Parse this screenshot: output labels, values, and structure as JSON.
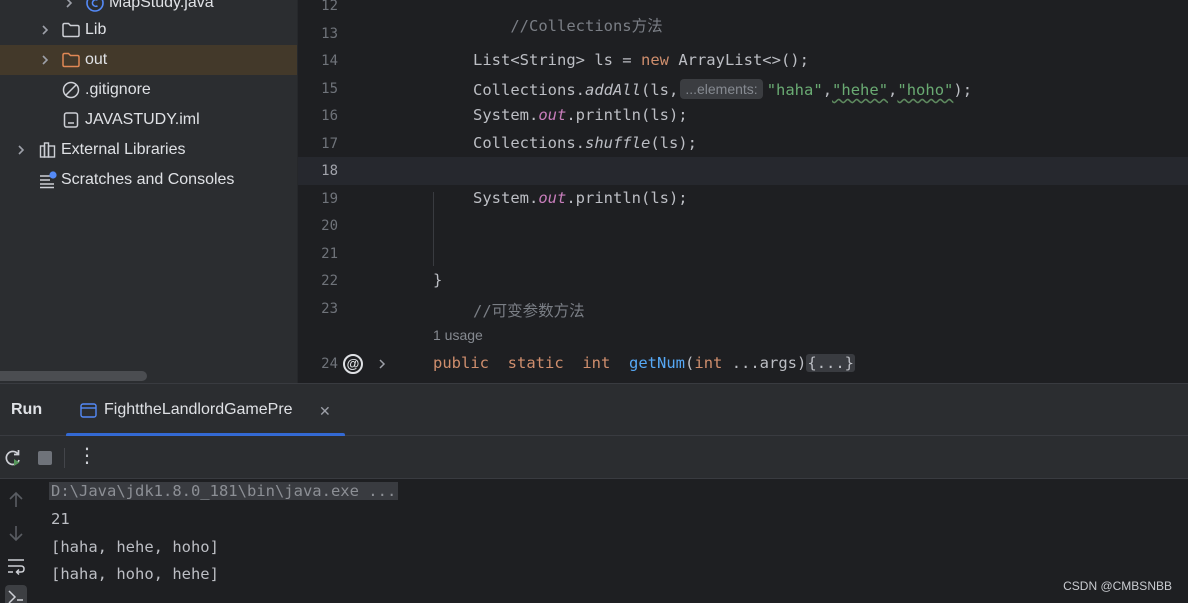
{
  "project_tree": {
    "items": [
      {
        "label": "MapStudy.java",
        "kind": "java-class",
        "expanded": false
      },
      {
        "label": "Lib",
        "kind": "folder",
        "expanded": false
      },
      {
        "label": "out",
        "kind": "excluded-folder",
        "expanded": false,
        "selected": true
      },
      {
        "label": ".gitignore",
        "kind": "ignored-file"
      },
      {
        "label": "JAVASTUDY.iml",
        "kind": "module-file"
      },
      {
        "label": "External Libraries",
        "kind": "libraries",
        "expanded": false
      },
      {
        "label": "Scratches and Consoles",
        "kind": "scratches"
      }
    ]
  },
  "editor": {
    "line_numbers": [
      "12",
      "13",
      "14",
      "15",
      "16",
      "17",
      "18",
      "19",
      "20",
      "21",
      "22",
      "23",
      "24"
    ],
    "current_line": "18",
    "code": {
      "l12_comment": "//Collections方法",
      "l14_type": "List<String> ls = ",
      "l14_new": "new",
      "l14_rest": " ArrayList<>();",
      "l15_a": "Collections.",
      "l15_method": "addAll",
      "l15_b": "(ls,",
      "l15_hint": "...elements:",
      "l15_s1": "\"haha\"",
      "l15_c1": ",",
      "l15_s2": "\"hehe\"",
      "l15_c2": ",",
      "l15_s3": "\"hoho\"",
      "l15_end": ");",
      "l16_a": "System.",
      "l16_field": "out",
      "l16_b": ".println(ls);",
      "l17_a": "Collections.",
      "l17_method": "shuffle",
      "l17_b": "(ls);",
      "l19_a": "System.",
      "l19_field": "out",
      "l19_b": ".println(ls);",
      "l22_brace": "}",
      "l23_comment": "//可变参数方法",
      "usage_hint": "1 usage",
      "l24_public": "public",
      "l24_static": "static",
      "l24_int": "int",
      "l24_name": "getNum",
      "l24_open": "(",
      "l24_int2": "int",
      "l24_args": " ...args)",
      "l24_fold": "{...}"
    },
    "gutter_marker": "@"
  },
  "run_panel": {
    "title": "Run",
    "tab_label": "FighttheLandlordGamePre",
    "close_glyph": "✕",
    "more_glyph": "⋮",
    "console_lines": [
      "D:\\Java\\jdk1.8.0_181\\bin\\java.exe ...",
      "21",
      "[haha, hehe, hoho]",
      "[haha, hoho, hehe]"
    ]
  },
  "watermark": "CSDN @CMBSNBB",
  "colors": {
    "keyword": "#cf8e6d",
    "string": "#6aab73",
    "comment": "#7a7e85",
    "field": "#c77dbb",
    "function": "#56a8f5",
    "accent": "#3574f0"
  }
}
